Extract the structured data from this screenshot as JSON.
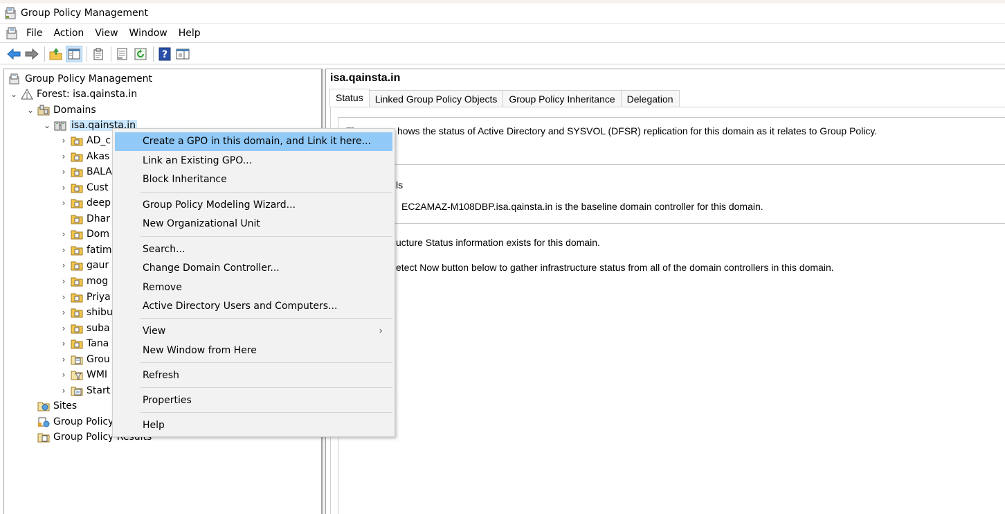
{
  "window": {
    "title": "Group Policy Management"
  },
  "menubar": {
    "items": [
      "File",
      "Action",
      "View",
      "Window",
      "Help"
    ]
  },
  "toolbar": {
    "buttons": [
      "back-arrow-icon",
      "forward-arrow-icon",
      "up-folder-icon",
      "show-hide-console-tree-icon",
      "clipboard-icon",
      "export-list-icon",
      "refresh-icon",
      "help-icon",
      "action-pane-icon"
    ]
  },
  "tree": {
    "root": "Group Policy Management",
    "forest": "Forest: isa.qainsta.in",
    "domains": "Domains",
    "domain": "isa.qainsta.in",
    "ous": [
      "AD_c",
      "Akas",
      "BALA",
      "Cust",
      "deep",
      "Dhar",
      "Dom",
      "fatim",
      "gaur",
      "mog",
      "Priya",
      "shibu",
      "suba",
      "Tana",
      "Grou",
      "WMI",
      "Start"
    ],
    "sites": "Sites",
    "modeling": "Group Policy",
    "results": "Group Policy Results"
  },
  "right": {
    "title": "isa.qainsta.in",
    "tabs": [
      "Status",
      "Linked Group Policy Objects",
      "Group Policy Inheritance",
      "Delegation"
    ],
    "line1_pre": "Th",
    "line1": "hows the status of Active Directory and SYSVOL (DFSR) replication for this domain as it relates to Group Policy.",
    "details_frag": "ls",
    "baseline": "EC2AMAZ-M108DBP.isa.qainsta.in is the baseline domain controller for this domain.",
    "infra_frag": "ucture Status information exists for this domain.",
    "detect_frag": "etect Now button below to gather infrastructure status from all of the domain controllers in this domain."
  },
  "context_menu": {
    "items": [
      "Create a GPO in this domain, and Link it here...",
      "Link an Existing GPO...",
      "Block Inheritance",
      "Group Policy Modeling Wizard...",
      "New Organizational Unit",
      "Search...",
      "Change Domain Controller...",
      "Remove",
      "Active Directory Users and Computers...",
      "View",
      "New Window from Here",
      "Refresh",
      "Properties",
      "Help"
    ],
    "submenu_arrow": "›"
  },
  "colors": {
    "highlight": "#91c9f7",
    "selection": "#cce8ff",
    "menu_bg": "#f2f2f2"
  }
}
